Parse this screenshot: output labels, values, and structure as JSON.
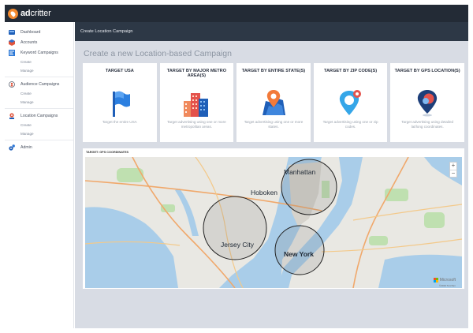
{
  "app": {
    "brand_prefix": "ad",
    "brand_suffix": "critter"
  },
  "header": {
    "title": "Create Location Campaign"
  },
  "sidebar": {
    "items": [
      {
        "label": "Dashboard",
        "icon": "dashboard-icon",
        "subs": []
      },
      {
        "label": "Accounts",
        "icon": "accounts-icon",
        "subs": []
      },
      {
        "label": "Keyword Campaigns",
        "icon": "keyword-campaigns-icon",
        "subs": [
          "Create",
          "Manage"
        ]
      },
      {
        "label": "Audience Campaigns",
        "icon": "audience-campaigns-icon",
        "subs": [
          "Create",
          "Manage"
        ]
      },
      {
        "label": "Location Campaigns",
        "icon": "location-campaigns-icon",
        "subs": [
          "Create",
          "Manage"
        ]
      },
      {
        "label": "Admin",
        "icon": "admin-icon",
        "subs": []
      }
    ]
  },
  "page": {
    "title": "Create a new Location-based Campaign"
  },
  "cards": [
    {
      "title": "TARGET USA",
      "desc": "Target the entire USA",
      "icon": "flag-icon"
    },
    {
      "title": "TARGET BY MAJOR METRO AREA(S)",
      "desc": "Target advertising using one or more metropolitan areas.",
      "icon": "city-buildings-icon"
    },
    {
      "title": "TARGET BY ENTIRE STATE(S)",
      "desc": "Target advertising using one or more states.",
      "icon": "state-pin-icon"
    },
    {
      "title": "TARGET BY ZIP CODE(S)",
      "desc": "Target advertising using one or zip codes.",
      "icon": "zip-pin-icon"
    },
    {
      "title": "TARGET BY GPS LOCATION(S)",
      "desc": "Target advertising using detailed lat/long coordinates.",
      "icon": "gps-pin-icon"
    }
  ],
  "map": {
    "label": "TARGET: GPS COORDINATES",
    "places": {
      "manhattan": "Manhattan",
      "hoboken": "Hoboken",
      "jersey_city": "Jersey City",
      "new_york": "New York"
    },
    "zoom_in": "+",
    "zoom_out": "−",
    "provider": "Microsoft",
    "copyright": "©2019 TomTom"
  },
  "colors": {
    "accent_orange": "#f28a30",
    "topbar": "#232b36",
    "header": "#2d3846",
    "water": "#a9cde9",
    "land": "#e9e8e3"
  }
}
